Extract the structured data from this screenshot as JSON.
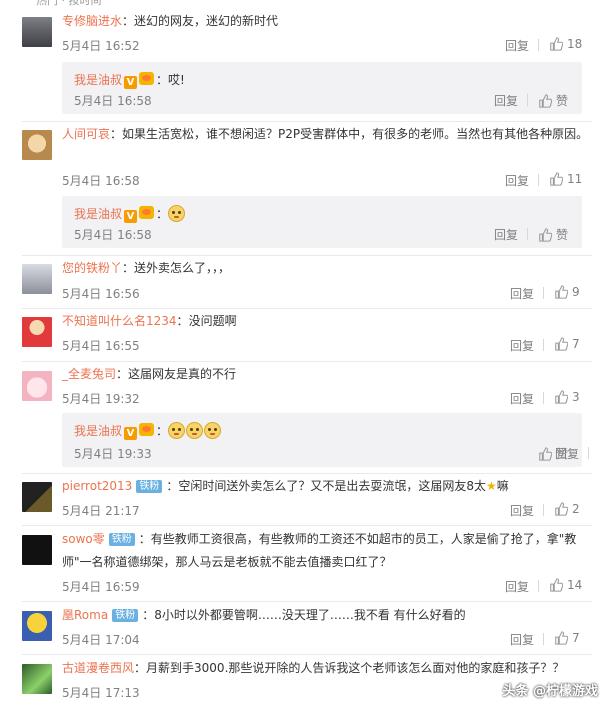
{
  "top_fragment": "热门 · 按时间",
  "reply_label": "回复",
  "like_label": "赞",
  "comments": [
    {
      "user": "专修脑进水",
      "text": "迷幻的网友，迷幻的新时代",
      "date": "5月4日 16:52",
      "likes": "18"
    },
    {
      "user": "人间可哀",
      "text": "如果生活宽松，谁不想闲适？P2P受害群体中，有很多的老师。当然也有其他各种原因。",
      "date": "5月4日 16:58",
      "likes": "11"
    },
    {
      "user": "您的铁粉丫",
      "text": "送外卖怎么了，，，",
      "date": "5月4日 16:56",
      "likes": "9"
    },
    {
      "user": "不知道叫什么名1234",
      "text": "没问题啊",
      "date": "5月4日 16:55",
      "likes": "7"
    },
    {
      "user": "_全麦兔司",
      "text": "这届网友是真的不行",
      "date": "5月4日 19:32",
      "likes": "3"
    },
    {
      "user": "pierrot2013",
      "badge": "铁粉",
      "text": "空闲时间送外卖怎么了？又不是出去耍流氓，这届网友8太",
      "text_tail": "嘛",
      "date": "5月4日 21:17",
      "likes": "2"
    },
    {
      "user": "sowo零",
      "badge": "铁粉",
      "text": "有些教师工资很高，有些教师的工资还不如超市的员工，人家是偷了抢了，拿\"教师\"一名称道德绑架，那人马云是老板就不能去值播卖口红了？",
      "date": "5月4日 16:59",
      "likes": "14"
    },
    {
      "user": "凰Roma",
      "badge": "铁粉",
      "text": "8小时以外都要管啊……没天理了……我不看 有什么好看的",
      "date": "5月4日 17:04",
      "likes": "7"
    },
    {
      "user": "古道漫卷西风",
      "text": "月薪到手3000.那些说开除的人告诉我这个老师该怎么面对他的家庭和孩子？？",
      "date": "5月4日 17:13"
    }
  ],
  "replies": [
    {
      "user": "我是油叔",
      "text": "哎!",
      "date": "5月4日 16:58"
    },
    {
      "user": "我是油叔",
      "text": "",
      "date": "5月4日 16:58"
    },
    {
      "user": "我是油叔",
      "text": "",
      "date": "5月4日 19:33"
    }
  ],
  "watermark": "头条 @柠檬游戏",
  "colors": {
    "username": "#eb7350",
    "meta": "#808080",
    "reply_bg": "#f2f2f5",
    "vip_badge": "#f69b00",
    "fan_badge": "#6ab0e0"
  }
}
